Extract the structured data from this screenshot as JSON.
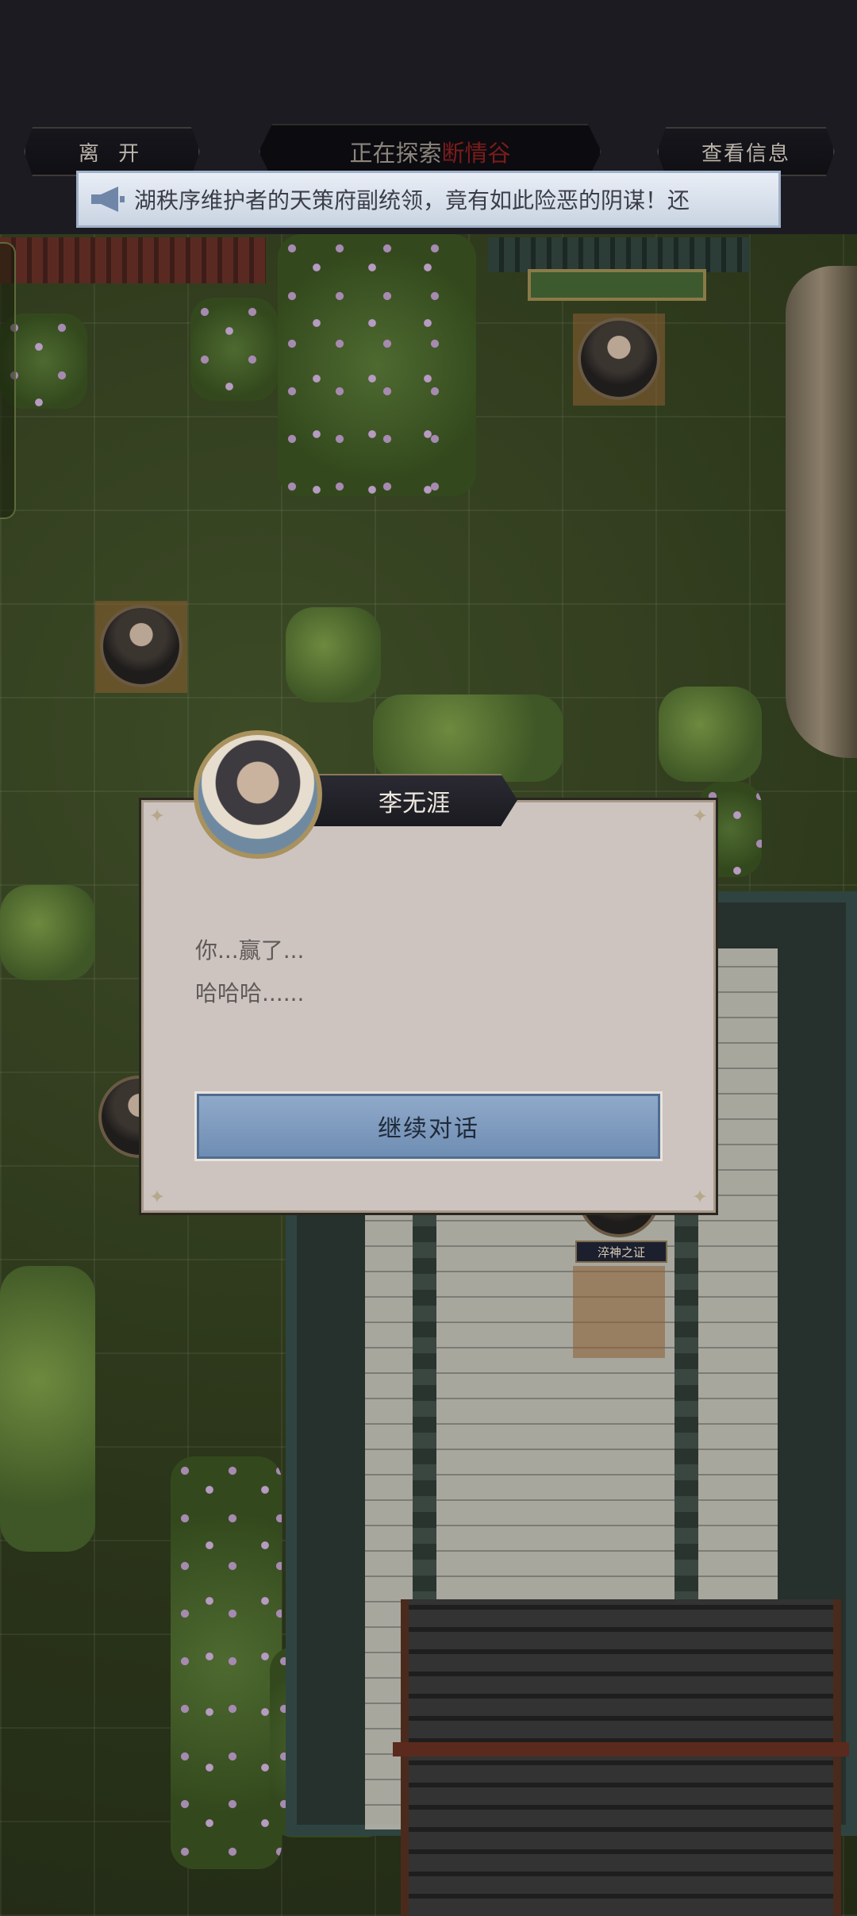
{
  "header": {
    "leave_label": "离 开",
    "exploring_prefix": "正在探索",
    "location_name": "断情谷",
    "info_label": "查看信息"
  },
  "announcement": {
    "icon": "megaphone-icon",
    "text": "湖秩序维护者的天策府副统领，竟有如此险恶的阴谋！还"
  },
  "map": {
    "unit_label": "淬神之证"
  },
  "dialog": {
    "speaker": "李无涯",
    "lines": [
      "你...赢了...",
      "哈哈哈......"
    ],
    "continue_label": "继续对话"
  },
  "colors": {
    "location_red": "#7a1c1c",
    "button_blue": "#8fa9c9",
    "dialog_bg": "#cdc4c0"
  }
}
